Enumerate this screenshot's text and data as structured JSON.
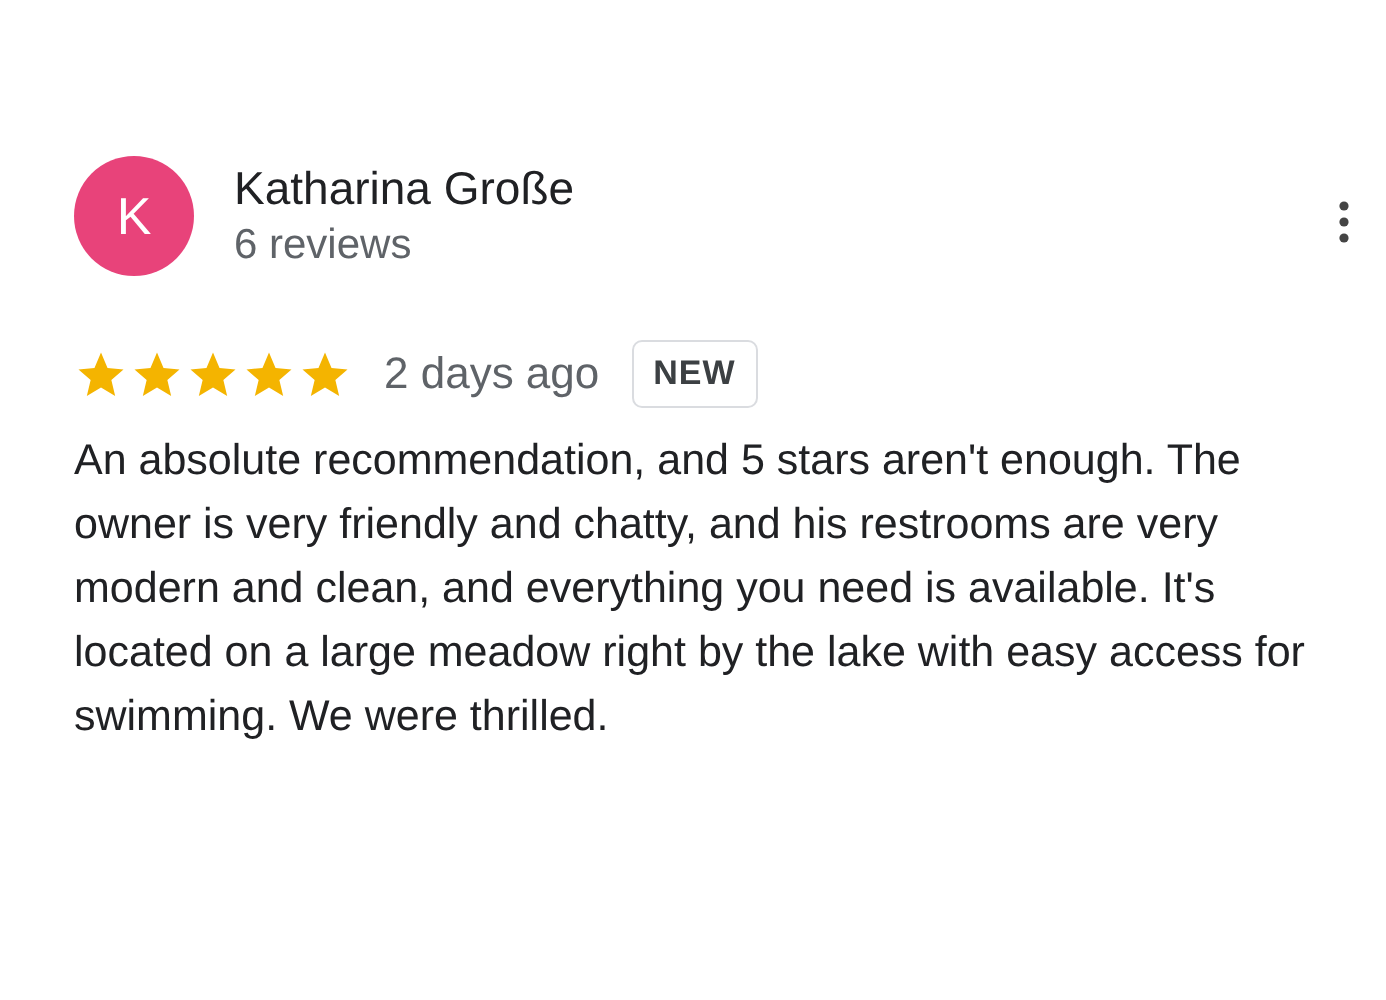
{
  "reviewer": {
    "initial": "K",
    "name": "Katharina Große",
    "reviews": "6 reviews"
  },
  "review": {
    "stars": 5,
    "time": "2 days ago",
    "badge": "NEW",
    "text": "An absolute recommendation, and 5 stars aren't enough. The owner is very friendly and chatty, and his restrooms are very modern and clean, and everything you need is available. It's located on a large meadow right by the lake with easy access for swimming. We were thrilled."
  }
}
